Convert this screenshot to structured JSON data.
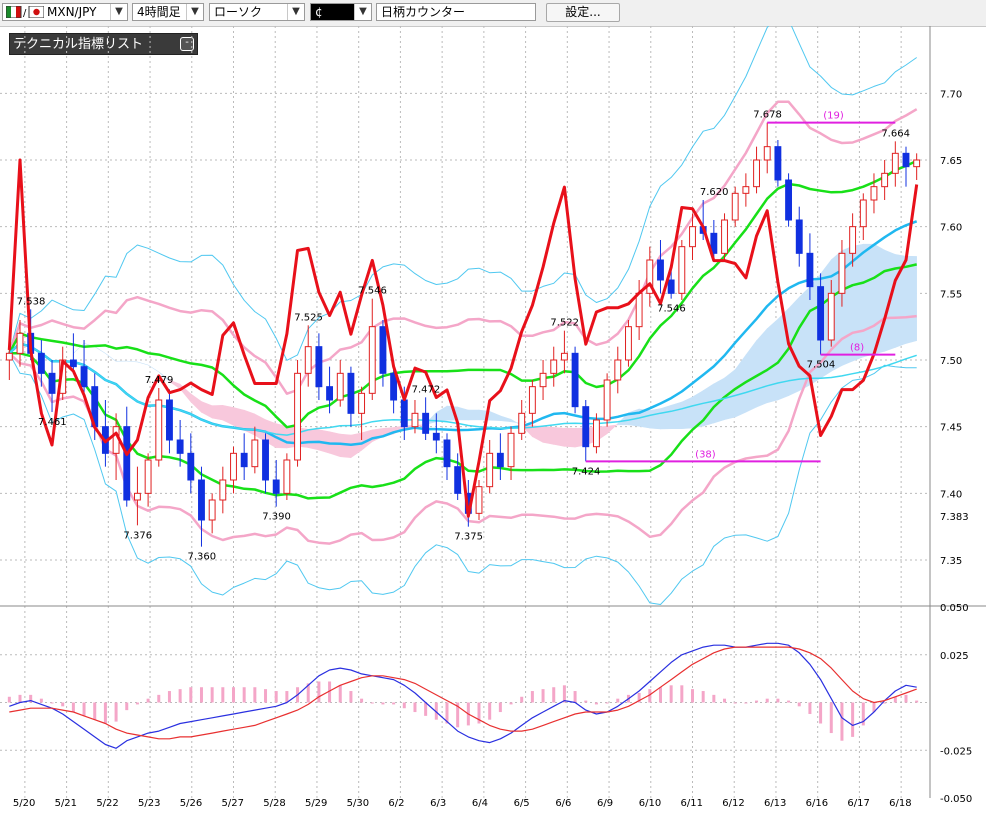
{
  "toolbar": {
    "symbol": "MXN/JPY",
    "timeframe": "4時間足",
    "chart_style": "ローソク",
    "draw_tool": "¢",
    "counter": "日柄カウンター",
    "settings_label": "設定..."
  },
  "indicator_panel": {
    "title": "テクニカル指標リスト"
  },
  "colors": {
    "up_candle": "#e02020",
    "down_candle": "#1030e0",
    "rsi_line": "#e8101a",
    "ma_green": "#18e018",
    "ma_cyan": "#20b8f0",
    "bb_pink": "#f4a6c8",
    "bb_outer": "#50c8f0",
    "cloud_pink": "#f8c8dc",
    "cloud_blue": "#c8e2f8",
    "counter_magenta": "#e020e0",
    "macd_line": "#2a30e0",
    "signal_line": "#e83030"
  },
  "chart_data": [
    {
      "type": "candlestick",
      "title": "",
      "ylim": [
        7.32,
        7.74
      ],
      "y_ticks": [
        "7.70",
        "7.65",
        "7.60",
        "7.55",
        "7.50",
        "7.45",
        "7.40",
        "7.35"
      ],
      "last_price_label": "7.383",
      "x_ticks": [
        "5/20",
        "5/21",
        "5/22",
        "5/23",
        "5/26",
        "5/27",
        "5/28",
        "5/29",
        "5/30",
        "6/2",
        "6/3",
        "6/4",
        "6/5",
        "6/6",
        "6/9",
        "6/10",
        "6/11",
        "6/12",
        "6/13",
        "6/16",
        "6/17",
        "6/18"
      ],
      "ohlc": [
        [
          7.5,
          7.515,
          7.485,
          7.505
        ],
        [
          7.505,
          7.53,
          7.495,
          7.52
        ],
        [
          7.52,
          7.538,
          7.5,
          7.505
        ],
        [
          7.505,
          7.515,
          7.48,
          7.49
        ],
        [
          7.49,
          7.5,
          7.461,
          7.475
        ],
        [
          7.475,
          7.51,
          7.47,
          7.5
        ],
        [
          7.5,
          7.52,
          7.49,
          7.495
        ],
        [
          7.495,
          7.515,
          7.475,
          7.48
        ],
        [
          7.48,
          7.49,
          7.44,
          7.45
        ],
        [
          7.45,
          7.47,
          7.42,
          7.43
        ],
        [
          7.43,
          7.46,
          7.41,
          7.45
        ],
        [
          7.45,
          7.465,
          7.39,
          7.395
        ],
        [
          7.395,
          7.42,
          7.376,
          7.4
        ],
        [
          7.4,
          7.43,
          7.39,
          7.425
        ],
        [
          7.425,
          7.479,
          7.42,
          7.47
        ],
        [
          7.47,
          7.478,
          7.43,
          7.44
        ],
        [
          7.44,
          7.455,
          7.42,
          7.43
        ],
        [
          7.43,
          7.445,
          7.4,
          7.41
        ],
        [
          7.41,
          7.42,
          7.36,
          7.38
        ],
        [
          7.38,
          7.4,
          7.37,
          7.395
        ],
        [
          7.395,
          7.42,
          7.385,
          7.41
        ],
        [
          7.41,
          7.435,
          7.4,
          7.43
        ],
        [
          7.43,
          7.445,
          7.41,
          7.42
        ],
        [
          7.42,
          7.45,
          7.415,
          7.44
        ],
        [
          7.44,
          7.445,
          7.4,
          7.41
        ],
        [
          7.41,
          7.425,
          7.39,
          7.4
        ],
        [
          7.4,
          7.43,
          7.395,
          7.425
        ],
        [
          7.425,
          7.5,
          7.42,
          7.49
        ],
        [
          7.49,
          7.526,
          7.48,
          7.51
        ],
        [
          7.51,
          7.52,
          7.47,
          7.48
        ],
        [
          7.48,
          7.495,
          7.46,
          7.47
        ],
        [
          7.47,
          7.5,
          7.465,
          7.49
        ],
        [
          7.49,
          7.495,
          7.45,
          7.46
        ],
        [
          7.46,
          7.48,
          7.44,
          7.475
        ],
        [
          7.475,
          7.546,
          7.47,
          7.525
        ],
        [
          7.525,
          7.53,
          7.48,
          7.49
        ],
        [
          7.49,
          7.5,
          7.46,
          7.47
        ],
        [
          7.47,
          7.48,
          7.44,
          7.45
        ],
        [
          7.45,
          7.47,
          7.445,
          7.46
        ],
        [
          7.46,
          7.472,
          7.44,
          7.445
        ],
        [
          7.445,
          7.46,
          7.43,
          7.44
        ],
        [
          7.44,
          7.445,
          7.41,
          7.42
        ],
        [
          7.42,
          7.43,
          7.395,
          7.4
        ],
        [
          7.4,
          7.41,
          7.375,
          7.385
        ],
        [
          7.385,
          7.41,
          7.38,
          7.405
        ],
        [
          7.405,
          7.44,
          7.4,
          7.43
        ],
        [
          7.43,
          7.445,
          7.41,
          7.42
        ],
        [
          7.42,
          7.45,
          7.41,
          7.445
        ],
        [
          7.445,
          7.47,
          7.44,
          7.46
        ],
        [
          7.46,
          7.485,
          7.45,
          7.48
        ],
        [
          7.48,
          7.5,
          7.47,
          7.49
        ],
        [
          7.49,
          7.51,
          7.48,
          7.5
        ],
        [
          7.5,
          7.522,
          7.49,
          7.505
        ],
        [
          7.505,
          7.51,
          7.46,
          7.465
        ],
        [
          7.465,
          7.47,
          7.424,
          7.435
        ],
        [
          7.435,
          7.46,
          7.43,
          7.455
        ],
        [
          7.455,
          7.49,
          7.45,
          7.485
        ],
        [
          7.485,
          7.51,
          7.475,
          7.5
        ],
        [
          7.5,
          7.53,
          7.495,
          7.525
        ],
        [
          7.525,
          7.56,
          7.515,
          7.55
        ],
        [
          7.55,
          7.585,
          7.54,
          7.575
        ],
        [
          7.575,
          7.59,
          7.55,
          7.56
        ],
        [
          7.56,
          7.57,
          7.546,
          7.55
        ],
        [
          7.55,
          7.59,
          7.545,
          7.585
        ],
        [
          7.585,
          7.61,
          7.575,
          7.6
        ],
        [
          7.6,
          7.62,
          7.59,
          7.595
        ],
        [
          7.595,
          7.605,
          7.575,
          7.58
        ],
        [
          7.58,
          7.61,
          7.575,
          7.605
        ],
        [
          7.605,
          7.63,
          7.6,
          7.625
        ],
        [
          7.625,
          7.64,
          7.615,
          7.63
        ],
        [
          7.63,
          7.66,
          7.625,
          7.65
        ],
        [
          7.65,
          7.678,
          7.64,
          7.66
        ],
        [
          7.66,
          7.665,
          7.63,
          7.635
        ],
        [
          7.635,
          7.64,
          7.6,
          7.605
        ],
        [
          7.605,
          7.615,
          7.57,
          7.58
        ],
        [
          7.58,
          7.595,
          7.545,
          7.555
        ],
        [
          7.555,
          7.565,
          7.504,
          7.515
        ],
        [
          7.515,
          7.56,
          7.51,
          7.55
        ],
        [
          7.55,
          7.59,
          7.54,
          7.58
        ],
        [
          7.58,
          7.61,
          7.57,
          7.6
        ],
        [
          7.6,
          7.625,
          7.59,
          7.62
        ],
        [
          7.62,
          7.64,
          7.61,
          7.63
        ],
        [
          7.63,
          7.65,
          7.62,
          7.64
        ],
        [
          7.64,
          7.664,
          7.63,
          7.655
        ],
        [
          7.655,
          7.66,
          7.63,
          7.645
        ],
        [
          7.645,
          7.655,
          7.635,
          7.65
        ]
      ],
      "price_labels": [
        {
          "text": "7.538",
          "bar": 2,
          "y": 7.538,
          "pos": "above"
        },
        {
          "text": "7.461",
          "bar": 4,
          "y": 7.461,
          "pos": "below"
        },
        {
          "text": "7.479",
          "bar": 14,
          "y": 7.479,
          "pos": "above"
        },
        {
          "text": "7.376",
          "bar": 12,
          "y": 7.376,
          "pos": "below"
        },
        {
          "text": "7.360",
          "bar": 18,
          "y": 7.36,
          "pos": "below"
        },
        {
          "text": "7.390",
          "bar": 25,
          "y": 7.39,
          "pos": "below"
        },
        {
          "text": "7.525",
          "bar": 28,
          "y": 7.526,
          "pos": "above"
        },
        {
          "text": "7.546",
          "bar": 34,
          "y": 7.546,
          "pos": "above"
        },
        {
          "text": "7.472",
          "bar": 39,
          "y": 7.472,
          "pos": "above"
        },
        {
          "text": "7.375",
          "bar": 43,
          "y": 7.375,
          "pos": "below"
        },
        {
          "text": "7.522",
          "bar": 52,
          "y": 7.522,
          "pos": "above"
        },
        {
          "text": "7.424",
          "bar": 54,
          "y": 7.424,
          "pos": "below"
        },
        {
          "text": "7.546",
          "bar": 62,
          "y": 7.546,
          "pos": "below"
        },
        {
          "text": "7.620",
          "bar": 66,
          "y": 7.62,
          "pos": "above"
        },
        {
          "text": "7.678",
          "bar": 71,
          "y": 7.678,
          "pos": "above"
        },
        {
          "text": "7.504",
          "bar": 76,
          "y": 7.504,
          "pos": "below"
        },
        {
          "text": "7.664",
          "bar": 83,
          "y": 7.664,
          "pos": "above"
        }
      ],
      "counters": [
        {
          "text": "(19)",
          "from": 71,
          "to": 83,
          "y": 7.678
        },
        {
          "text": "(38)",
          "from": 54,
          "to": 76,
          "y": 7.424
        },
        {
          "text": "(8)",
          "from": 76,
          "to": 83,
          "y": 7.504
        }
      ]
    },
    {
      "type": "macd",
      "ylim": [
        -0.05,
        0.05
      ],
      "y_ticks": [
        "0.050",
        "0.025",
        "-0.025",
        "-0.050"
      ],
      "macd": [
        -0.002,
        0.0,
        0.001,
        -0.001,
        -0.003,
        -0.006,
        -0.01,
        -0.014,
        -0.018,
        -0.022,
        -0.024,
        -0.02,
        -0.018,
        -0.016,
        -0.015,
        -0.013,
        -0.011,
        -0.01,
        -0.009,
        -0.008,
        -0.007,
        -0.006,
        -0.005,
        -0.004,
        -0.003,
        -0.002,
        0.0,
        0.004,
        0.009,
        0.014,
        0.017,
        0.018,
        0.017,
        0.015,
        0.014,
        0.013,
        0.012,
        0.009,
        0.005,
        0.0,
        -0.005,
        -0.01,
        -0.015,
        -0.018,
        -0.02,
        -0.021,
        -0.019,
        -0.016,
        -0.012,
        -0.008,
        -0.005,
        -0.002,
        0.001,
        0.0,
        -0.004,
        -0.006,
        -0.005,
        -0.002,
        0.002,
        0.006,
        0.011,
        0.016,
        0.021,
        0.025,
        0.027,
        0.029,
        0.03,
        0.03,
        0.029,
        0.029,
        0.03,
        0.031,
        0.031,
        0.03,
        0.026,
        0.02,
        0.012,
        0.002,
        -0.008,
        -0.012,
        -0.01,
        -0.005,
        0.001,
        0.006,
        0.009,
        0.008
      ],
      "signal": [
        -0.005,
        -0.004,
        -0.003,
        -0.003,
        -0.003,
        -0.004,
        -0.005,
        -0.007,
        -0.009,
        -0.011,
        -0.014,
        -0.016,
        -0.017,
        -0.018,
        -0.019,
        -0.019,
        -0.018,
        -0.018,
        -0.017,
        -0.016,
        -0.015,
        -0.014,
        -0.013,
        -0.012,
        -0.01,
        -0.008,
        -0.006,
        -0.004,
        -0.001,
        0.003,
        0.006,
        0.009,
        0.011,
        0.013,
        0.014,
        0.014,
        0.013,
        0.012,
        0.01,
        0.007,
        0.004,
        0.001,
        -0.002,
        -0.006,
        -0.009,
        -0.012,
        -0.014,
        -0.015,
        -0.015,
        -0.014,
        -0.012,
        -0.01,
        -0.008,
        -0.006,
        -0.005,
        -0.005,
        -0.005,
        -0.004,
        -0.002,
        0.001,
        0.004,
        0.008,
        0.012,
        0.016,
        0.02,
        0.023,
        0.026,
        0.028,
        0.029,
        0.029,
        0.029,
        0.029,
        0.029,
        0.029,
        0.028,
        0.026,
        0.023,
        0.018,
        0.012,
        0.006,
        0.002,
        0.0,
        0.001,
        0.003,
        0.005,
        0.007
      ]
    }
  ]
}
